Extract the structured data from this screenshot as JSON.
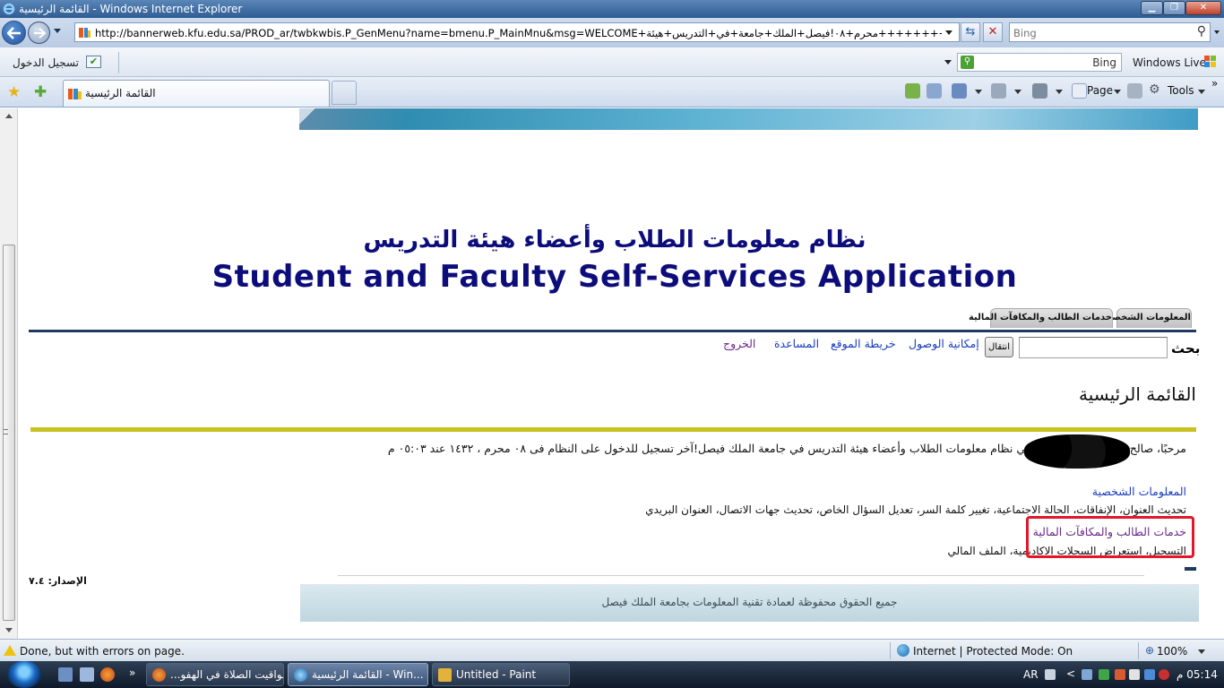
{
  "window": {
    "title": "القائمة الرئيسية - Windows Internet Explorer"
  },
  "address": {
    "url": "http://bannerweb.kfu.edu.sa/PROD_ar/twbkwbis.P_GenMenu?name=bmenu.P_MainMnu&msg=WELCOME+٣%١٤٣٢٠٥+،+++++++++محرم+٠٨!فيصل+الملك+جامعة+في+التدريس+هيئة",
    "search_placeholder": "Bing"
  },
  "links_bar": {
    "signin": "تسجيل الدخول",
    "bing_label": "Bing",
    "live_label": "Windows Live"
  },
  "tabs": {
    "active_tab": "القائمة الرئيسية"
  },
  "commands": {
    "page": "Page",
    "tools": "Tools",
    "chevron": "»"
  },
  "page": {
    "ar_title": "نظام معلومات الطلاب وأعضاء هيئة التدريس",
    "en_title": "Student and Faculty Self-Services Application",
    "nav_tabs": {
      "personal": "المعلومات الشخصية",
      "student": "خدمات الطالب والمكافآت المالية"
    },
    "search_label": "بحث",
    "go_button": "انتقال",
    "links": {
      "accessibility": "إمكانية الوصول",
      "sitemap": "خريطة الموقع",
      "help": "المساعدة",
      "logout": "الخروج"
    },
    "main_heading": "القائمة الرئيسية",
    "welcome_prefix": "مرحبًا، صالح",
    "welcome_rest": "، في نظام معلومات الطلاب وأعضاء هيئة التدريس في جامعة الملك فيصل!آخر تسجيل للدخول على النظام فى ٠٨ محرم ، ١٤٣٢ عند ٠٥:٠٣ م",
    "personal_link": "المعلومات الشخصية",
    "personal_desc": "تحديث العنوان، الإنفاقات، الحالة الاجتماعية، تغيير كلمة السر، تعديل السؤال الخاص، تحديث جهات الاتصال، العنوان البريدي",
    "student_link": "خدمات الطالب والمكافآت المالية",
    "student_desc": "التسجيل، استعراض السجلات الاكاديمية، الملف المالي",
    "version": "الإصدار: ٧.٤",
    "footer": "جميع الحقوق محفوظة لعمادة تقنية المعلومات بجامعة الملك فيصل"
  },
  "status": {
    "text": "Done, but with errors on page.",
    "zone": "Internet | Protected Mode: On",
    "zoom": "100%"
  },
  "taskbar": {
    "items": [
      {
        "label": "مواقيت الصلاة في الهفو..."
      },
      {
        "label": "القائمة الرئيسية - Win..."
      },
      {
        "label": "Untitled - Paint"
      }
    ],
    "quicklaunch_more": "»",
    "lang": "AR",
    "tray_more": "<",
    "clock": "05:14 م"
  },
  "colors": {
    "title_blue": "#0c0c7a",
    "link_blue": "#1a3dc1",
    "visited_purple": "#6b2a8a",
    "highlight_red": "#e3162a",
    "rule_yellow": "#c8c221",
    "rule_navy": "#1f3a60"
  }
}
